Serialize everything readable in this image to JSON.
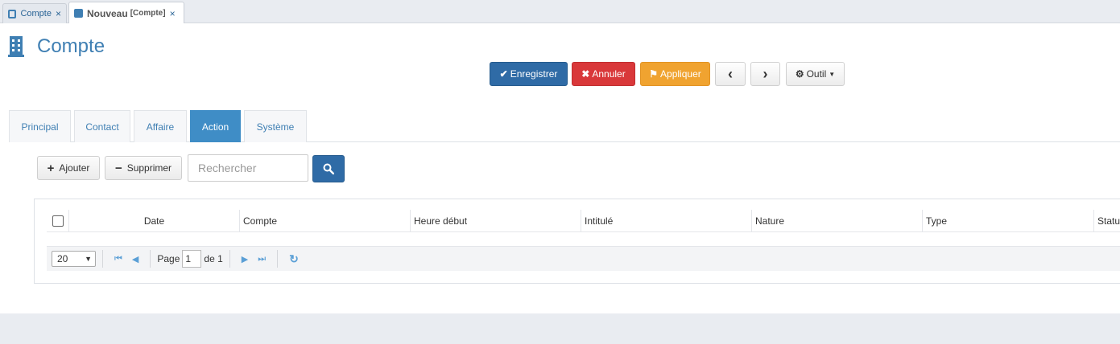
{
  "doc_tabs": [
    {
      "label": "Compte",
      "close": "×"
    },
    {
      "label": "Nouveau",
      "sublabel": "[Compte]",
      "close": "×"
    }
  ],
  "page": {
    "title": "Compte",
    "icon": "building-icon"
  },
  "actions": {
    "save": "Enregistrer",
    "cancel": "Annuler",
    "apply": "Appliquer",
    "prev_icon": "‹",
    "next_icon": "›",
    "tools": "Outil"
  },
  "section_tabs": [
    "Principal",
    "Contact",
    "Affaire",
    "Action",
    "Système"
  ],
  "active_section_tab": "Action",
  "toolbar": {
    "add": "Ajouter",
    "delete": "Supprimer",
    "search_placeholder": "Rechercher"
  },
  "grid": {
    "columns": [
      "Date",
      "Compte",
      "Heure début",
      "Intitulé",
      "Nature",
      "Type",
      "Statut"
    ],
    "rows": []
  },
  "pager": {
    "page_size": "20",
    "page_label": "Page",
    "page_value": "1",
    "of_label": "de 1"
  },
  "colors": {
    "primary": "#2f6ba6",
    "danger": "#d9383a",
    "warning": "#f0a330",
    "accent": "#3f7fb3",
    "active_tab": "#3f8dc6"
  }
}
